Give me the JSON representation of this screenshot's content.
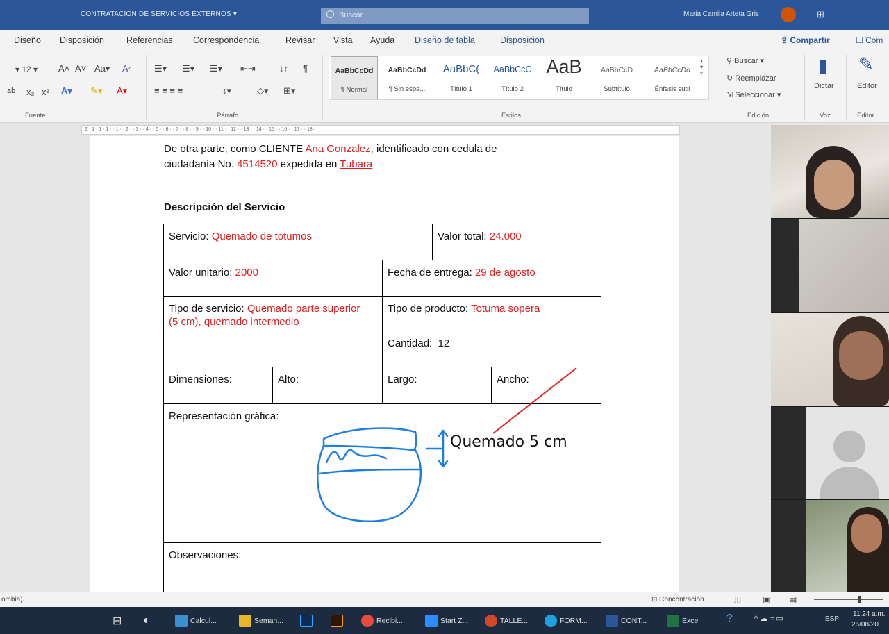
{
  "window": {
    "doc_title": "CONTRATACIÓN DE SERVICIOS EXTERNOS",
    "search_placeholder": "Buscar",
    "user_name": "Maria Camila Arteta Gris"
  },
  "menu": {
    "tabs": [
      "Diseño",
      "Disposición",
      "Referencias",
      "Correspondencia",
      "Revisar",
      "Vista",
      "Ayuda",
      "Diseño de tabla",
      "Disposición"
    ],
    "share": "Compartir",
    "comments": "Com"
  },
  "ribbon": {
    "font_size": "12",
    "groups": {
      "font": "Fuente",
      "paragraph": "Párrafo",
      "styles": "Estilos",
      "edit": "Edición",
      "voice": "Voz",
      "editor": "Editor"
    },
    "styles": [
      {
        "preview": "AaBbCcDd",
        "name": "¶ Normal"
      },
      {
        "preview": "AaBbCcDd",
        "name": "¶ Sin espa..."
      },
      {
        "preview": "AaBbC(",
        "name": "Título 1"
      },
      {
        "preview": "AaBbCcC",
        "name": "Título 2"
      },
      {
        "preview": "AaB",
        "name": "Título"
      },
      {
        "preview": "AaBbCcD",
        "name": "Subtítulo"
      },
      {
        "preview": "AaBbCcDd",
        "name": "Énfasis sutil"
      }
    ],
    "find": "Buscar",
    "replace": "Reemplazar",
    "select": "Seleccionar",
    "dictate": "Dictar",
    "editor_btn": "Editor"
  },
  "ruler_text": "2 · 1 · 1 · 1 · · 1 · · 2 · · 3 · · 4 · · 5 · · 6 · · 7 · · 8 · · 9 · · 10 · · 11 · · 12 · · 13 · · 14 · · 15 · · 16 · · 17 · · 18 ·",
  "document": {
    "line1_prefix": "De otra parte, como CLIENTE ",
    "client_first": "Ana ",
    "client_last": "Gonzalez",
    "line1_suffix": ", identificado con cedula de",
    "line2_prefix": "ciudadanía No. ",
    "id_number": "4514520",
    "line2_mid": " expedida en ",
    "city": "Tubara",
    "section_heading": "Descripción del Servicio",
    "table": {
      "servicio_label": "Servicio: ",
      "servicio_value": "Quemado de totumos",
      "valor_total_label": "Valor total: ",
      "valor_total_value": "24.000",
      "valor_unitario_label": "Valor unitario: ",
      "valor_unitario_value": "2000",
      "fecha_label": "Fecha de entrega: ",
      "fecha_value": "29 de agosto",
      "tipo_servicio_label": "Tipo de servicio: ",
      "tipo_servicio_value": "Quemado parte superior (5 cm), quemado intermedio",
      "tipo_producto_label": "Tipo de producto: ",
      "tipo_producto_value": "Totuma sopera",
      "cantidad_label": "Cantidad:",
      "cantidad_value": "12",
      "dimensiones": "Dimensiones:",
      "alto": "Alto:",
      "largo": "Largo:",
      "ancho": "Ancho:",
      "representacion": "Representación gráfica:",
      "observaciones": "Observaciones:"
    },
    "annotation": "Quemado 5 cm"
  },
  "status": {
    "language": "ombia)",
    "focus": "Concentración"
  },
  "taskbar": {
    "items": [
      "Calcul...",
      "Seman...",
      "Recibi...",
      "Start Z...",
      "TALLE...",
      "FORM...",
      "CONT...",
      "Excel"
    ],
    "lang": "ESP",
    "time": "11:24 a.m.",
    "date": "26/08/20"
  },
  "colors": {
    "accent": "#2b579a",
    "red_text": "#e02020",
    "sketch_blue": "#1e7fe0"
  }
}
